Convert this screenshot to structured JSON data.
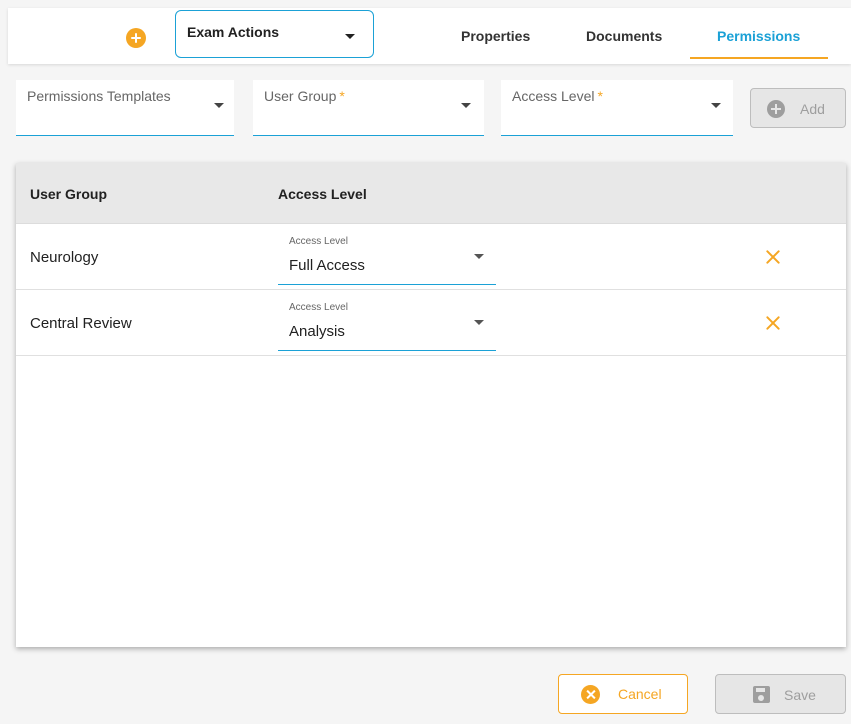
{
  "header": {
    "add_icon": "plus-circle-icon",
    "exam_actions_label": "Exam Actions",
    "tabs": [
      {
        "label": "Properties",
        "active": false
      },
      {
        "label": "Documents",
        "active": false
      },
      {
        "label": "Permissions",
        "active": true
      }
    ]
  },
  "form": {
    "permissions_templates": {
      "label": "Permissions Templates",
      "value": ""
    },
    "user_group": {
      "label": "User Group",
      "required_mark": "*",
      "value": ""
    },
    "access_level": {
      "label": "Access Level",
      "required_mark": "*",
      "value": ""
    },
    "add_button": {
      "label": "Add",
      "enabled": false
    }
  },
  "table": {
    "columns": [
      "User Group",
      "Access Level"
    ],
    "rows": [
      {
        "user_group": "Neurology",
        "access_level_label": "Access Level",
        "access_level": "Full Access"
      },
      {
        "user_group": "Central Review",
        "access_level_label": "Access Level",
        "access_level": "Analysis"
      }
    ]
  },
  "footer": {
    "cancel_label": "Cancel",
    "save_label": "Save",
    "save_enabled": false
  },
  "colors": {
    "accent_orange": "#f5a623",
    "accent_blue": "#1ba1d6",
    "disabled_gray": "#9e9e9e"
  }
}
